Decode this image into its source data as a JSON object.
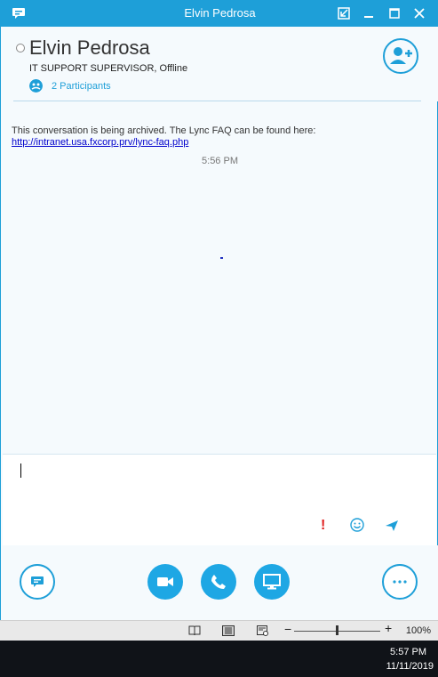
{
  "window": {
    "title": "Elvin Pedrosa"
  },
  "contact": {
    "name": "Elvin Pedrosa",
    "status": "IT SUPPORT SUPERVISOR,  Offline",
    "participants": "2 Participants"
  },
  "conversation": {
    "archive_notice": "This conversation is being archived. The Lync FAQ can be found here:",
    "faq_link": "http://intranet.usa.fxcorp.prv/lync-faq.php",
    "timestamp": "5:56 PM"
  },
  "compose": {
    "importance_glyph": "!"
  },
  "statusbar": {
    "zoom": "100%",
    "zoom_level": 0.5
  },
  "taskbar": {
    "time": "5:57 PM",
    "date": "11/11/2019"
  },
  "colors": {
    "accent": "#1e9fd8",
    "importance": "#e02020",
    "link": "#0000cc"
  }
}
